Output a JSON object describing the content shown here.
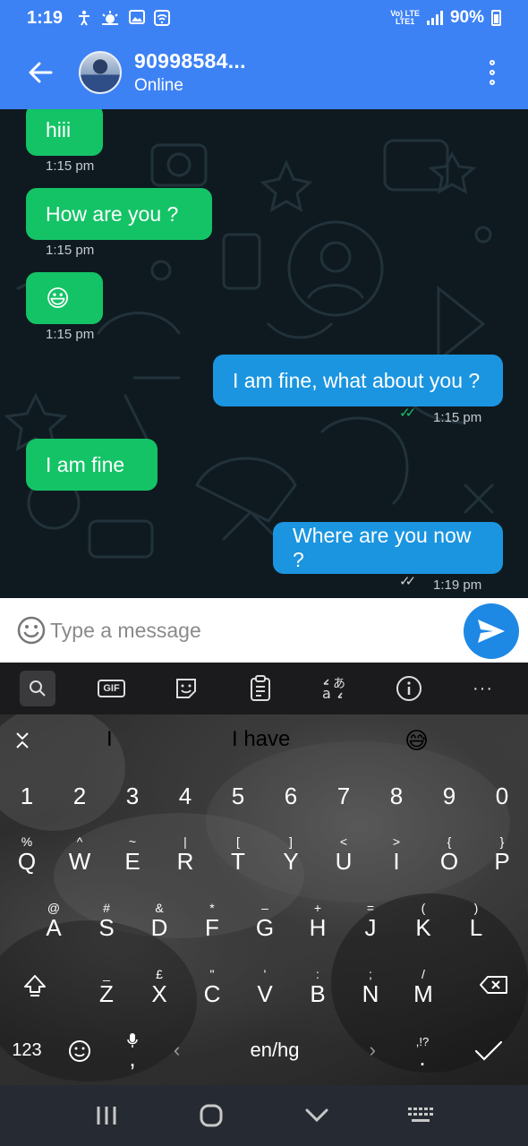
{
  "status_bar": {
    "time": "1:19",
    "network_top": "Vo) LTE",
    "network_bottom": "LTE1",
    "battery": "90%"
  },
  "header": {
    "contact_name": "90998584...",
    "contact_status": "Online"
  },
  "messages": [
    {
      "direction": "in",
      "text": "hiii",
      "time": "1:15 pm"
    },
    {
      "direction": "in",
      "text": "How are you ?",
      "time": "1:15 pm"
    },
    {
      "direction": "in",
      "text": "😃",
      "time": "1:15 pm"
    },
    {
      "direction": "out",
      "text": "I am fine, what about you ?",
      "time": "1:15 pm",
      "ticks": "✓✓",
      "tick_color": "#14c366"
    },
    {
      "direction": "in",
      "text": "I am fine",
      "time": ""
    },
    {
      "direction": "out",
      "text": "Where are you now ?",
      "time": "1:19 pm",
      "ticks": "✓✓",
      "tick_color": "#d0d0d0"
    }
  ],
  "input": {
    "placeholder": "Type a message"
  },
  "keyboard": {
    "toolbar_gif": "GIF",
    "toolbar_more": "···",
    "suggestions": [
      "I",
      "I have",
      "😅"
    ],
    "numbers": [
      "1",
      "2",
      "3",
      "4",
      "5",
      "6",
      "7",
      "8",
      "9",
      "0"
    ],
    "row1": [
      {
        "hint": "%",
        "key": "Q"
      },
      {
        "hint": "^",
        "key": "W"
      },
      {
        "hint": "~",
        "key": "E"
      },
      {
        "hint": "|",
        "key": "R"
      },
      {
        "hint": "[",
        "key": "T"
      },
      {
        "hint": "]",
        "key": "Y"
      },
      {
        "hint": "<",
        "key": "U"
      },
      {
        "hint": ">",
        "key": "I"
      },
      {
        "hint": "{",
        "key": "O"
      },
      {
        "hint": "}",
        "key": "P"
      }
    ],
    "row2": [
      {
        "hint": "@",
        "key": "A"
      },
      {
        "hint": "#",
        "key": "S"
      },
      {
        "hint": "&",
        "key": "D"
      },
      {
        "hint": "*",
        "key": "F"
      },
      {
        "hint": "–",
        "key": "G"
      },
      {
        "hint": "+",
        "key": "H"
      },
      {
        "hint": "=",
        "key": "J"
      },
      {
        "hint": "(",
        "key": "K"
      },
      {
        "hint": ")",
        "key": "L"
      }
    ],
    "row3": [
      {
        "hint": "_",
        "key": "Z"
      },
      {
        "hint": "£",
        "key": "X"
      },
      {
        "hint": "\"",
        "key": "C"
      },
      {
        "hint": "'",
        "key": "V"
      },
      {
        "hint": ":",
        "key": "B"
      },
      {
        "hint": ";",
        "key": "N"
      },
      {
        "hint": "/",
        "key": "M"
      }
    ],
    "sym_key": "123",
    "comma_key": ",",
    "space_label": "en/hg",
    "period_hint": ",!?",
    "period_key": "."
  },
  "colors": {
    "app_bar": "#3d82f5",
    "incoming_bubble": "#14c366",
    "outgoing_bubble": "#1b95e0",
    "send_button": "#1e88e5"
  }
}
